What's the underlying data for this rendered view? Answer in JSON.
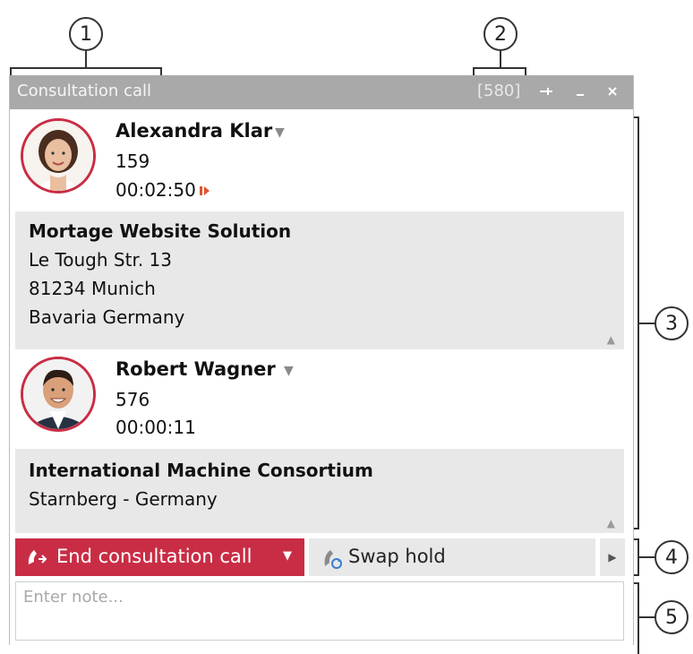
{
  "callouts": [
    "1",
    "2",
    "3",
    "4",
    "5"
  ],
  "window": {
    "title": "Consultation call",
    "id_badge": "[580]",
    "controls": {
      "pin": "pin-icon",
      "minimize": "minimize-icon",
      "close": "close-icon"
    }
  },
  "calls": [
    {
      "name": "Alexandra Klar",
      "number": "159",
      "duration": "00:02:50",
      "status_icon": "speaking-indicator-icon",
      "info": [
        "Mortage Website Solution",
        "Le Tough Str. 13",
        "81234 Munich",
        "Bavaria Germany"
      ]
    },
    {
      "name": "Robert Wagner",
      "number": "576",
      "duration": "00:00:11",
      "info": [
        "International Machine Consortium",
        "Starnberg - Germany"
      ]
    }
  ],
  "actions": {
    "end_label": "End consultation call",
    "swap_label": "Swap hold"
  },
  "note": {
    "placeholder": "Enter note..."
  },
  "colors": {
    "accent": "#c92d45",
    "titlebar": "#a9a9a9",
    "panel": "#e8e8e8"
  }
}
